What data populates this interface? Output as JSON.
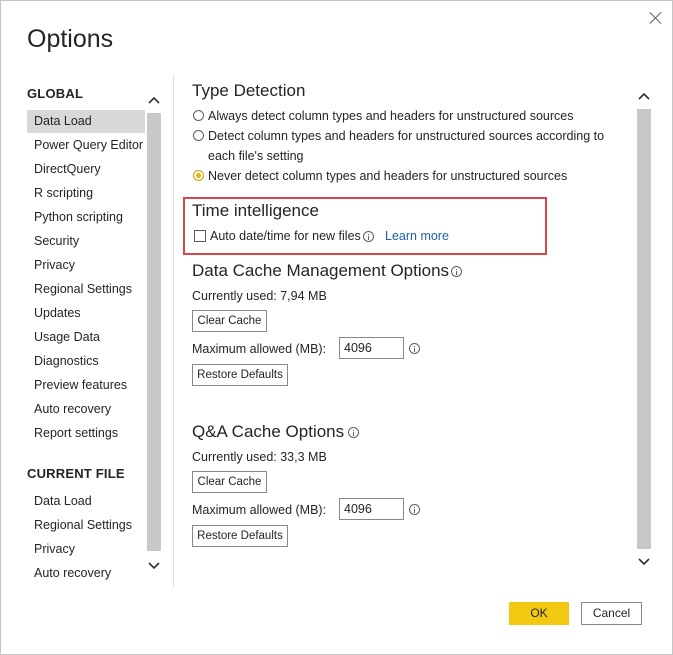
{
  "dialog": {
    "title": "Options",
    "ok_label": "OK",
    "cancel_label": "Cancel"
  },
  "nav": {
    "global_heading": "GLOBAL",
    "global_items": [
      {
        "label": "Data Load",
        "selected": true
      },
      {
        "label": "Power Query Editor"
      },
      {
        "label": "DirectQuery"
      },
      {
        "label": "R scripting"
      },
      {
        "label": "Python scripting"
      },
      {
        "label": "Security"
      },
      {
        "label": "Privacy"
      },
      {
        "label": "Regional Settings"
      },
      {
        "label": "Updates"
      },
      {
        "label": "Usage Data"
      },
      {
        "label": "Diagnostics"
      },
      {
        "label": "Preview features"
      },
      {
        "label": "Auto recovery"
      },
      {
        "label": "Report settings"
      }
    ],
    "current_heading": "CURRENT FILE",
    "current_items": [
      {
        "label": "Data Load"
      },
      {
        "label": "Regional Settings"
      },
      {
        "label": "Privacy"
      },
      {
        "label": "Auto recovery"
      }
    ]
  },
  "type_detection": {
    "title": "Type Detection",
    "options": [
      {
        "label": "Always detect column types and headers for unstructured sources",
        "checked": false
      },
      {
        "label": "Detect column types and headers for unstructured sources according to",
        "label2": "each file's setting",
        "checked": false
      },
      {
        "label": "Never detect column types and headers for unstructured sources",
        "checked": true
      }
    ]
  },
  "time_intelligence": {
    "title": "Time intelligence",
    "checkbox_label": "Auto date/time for new files",
    "checked": false,
    "learn_more": "Learn more"
  },
  "data_cache": {
    "title": "Data Cache Management Options",
    "currently_used": "Currently used: 7,94 MB",
    "clear_label": "Clear Cache",
    "max_label": "Maximum allowed (MB):",
    "max_value": "4096",
    "restore_label": "Restore Defaults"
  },
  "qa_cache": {
    "title": "Q&A Cache Options",
    "currently_used": "Currently used: 33,3 MB",
    "clear_label": "Clear Cache",
    "max_label": "Maximum allowed (MB):",
    "max_value": "4096",
    "restore_label": "Restore Defaults"
  },
  "colors": {
    "accent_yellow": "#f2c811",
    "highlight_red": "#d9474b",
    "selected_bg": "#d8d8d8",
    "link": "#1a5fb4"
  }
}
